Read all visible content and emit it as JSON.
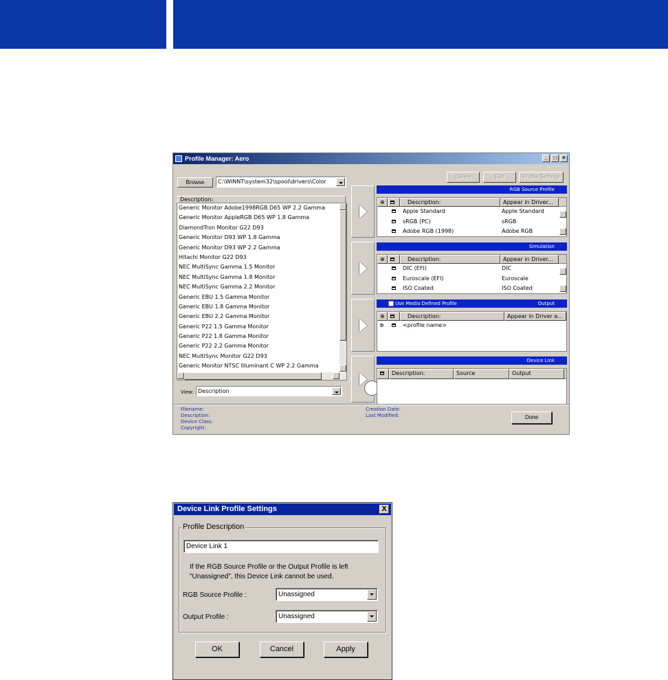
{
  "colors": {
    "header_band": "#0b36a8",
    "section_header": "#0a24c8",
    "status_text": "#1d2fa0"
  },
  "profile_manager": {
    "title": "Profile Manager: Aero",
    "browse_label": "Browse",
    "path": "C:\\WINNT\\system32\\spool\\drivers\\Color",
    "delete_label": "Delete",
    "edit_label": "Edit",
    "settings_label": "Profile Settings",
    "left_header": "Description:",
    "profiles": [
      "Generic Monitor Adobe1998RGB D65 WP 2.2 Gamma",
      "Generic Monitor AppleRGB D65 WP 1.8 Gamma",
      "DiamondTron Monitor G22 D93",
      "Generic Monitor D93 WP 1.8 Gamma",
      "Generic Monitor D93 WP 2.2 Gamma",
      "Hitachi Monitor G22 D93",
      "NEC MultiSync Gamma 1.5 Monitor",
      "NEC MultiSync Gamma 1.8 Monitor",
      "NEC MultiSync Gamma 2.2 Monitor",
      "Generic EBU 1.5 Gamma Monitor",
      "Generic EBU 1.8 Gamma Monitor",
      "Generic EBU 2.2 Gamma Monitor",
      "Generic P22 1.5 Gamma Monitor",
      "Generic P22 1.8 Gamma Monitor",
      "Generic P22 2.2 Gamma Monitor",
      "NEC MultiSync Monitor G22 D93",
      "Generic Monitor NTSC Illuminant C WP 2.2 Gamma"
    ],
    "view_label": "View:",
    "view_value": "Description",
    "rgb_source": {
      "header": "RGB Source Profile",
      "col_desc": "Description:",
      "col_appear": "Appear in Driver...",
      "rows": [
        {
          "desc": "Apple Standard",
          "appear": "Apple Standard"
        },
        {
          "desc": "sRGB (PC)",
          "appear": "sRGB"
        },
        {
          "desc": "Adobe RGB (1998)",
          "appear": "Adobe RGB"
        }
      ]
    },
    "simulation": {
      "header": "Simulation",
      "col_desc": "Description:",
      "col_appear": "Appear in Driver...",
      "rows": [
        {
          "desc": "DIC (EFI)",
          "appear": "DIC"
        },
        {
          "desc": "Euroscale (EFI)",
          "appear": "Euroscale"
        },
        {
          "desc": "ISO Coated",
          "appear": "ISO Coated"
        }
      ]
    },
    "output": {
      "checkbox_label": "Use Media Defined Profile",
      "header": "Output",
      "col_desc": "Description:",
      "col_appear": "Appear in Driver a...",
      "rows": [
        {
          "desc": "<profile name>"
        }
      ]
    },
    "device_link": {
      "header": "Device Link",
      "col_desc": "Description:",
      "col_source": "Source",
      "col_output": "Output"
    },
    "status": {
      "filename": "Filename:",
      "description": "Description:",
      "device_class": "Device Class:",
      "copyright": "Copyright:",
      "creation_date": "Creation Date:",
      "last_modified": "Last Modified:"
    },
    "done_label": "Done"
  },
  "device_link_dialog": {
    "title": "Device Link Profile Settings",
    "close": "X",
    "group_label": "Profile Description",
    "description_value": "Device Link 1",
    "info_line1": "If the RGB Source Profile or the Output Profile is left",
    "info_line2": "\"Unassigned\", this Device Link cannot be used.",
    "rgb_source_label": "RGB Source Profile :",
    "rgb_source_value": "Unassigned",
    "output_label": "Output Profile :",
    "output_value": "Unassigned",
    "ok_label": "OK",
    "cancel_label": "Cancel",
    "apply_label": "Apply"
  }
}
